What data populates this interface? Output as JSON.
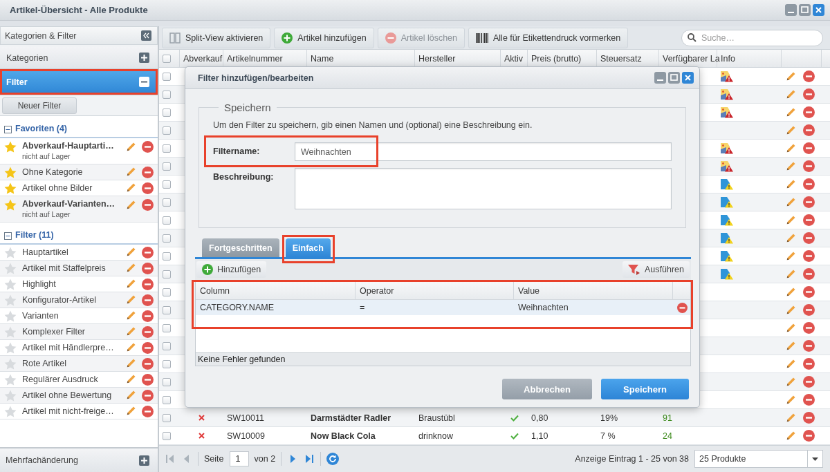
{
  "window": {
    "title": "Artikel-Übersicht - Alle Produkte"
  },
  "sidebar": {
    "title": "Kategorien & Filter",
    "sections": [
      {
        "label": "Kategorien",
        "expanded": false
      },
      {
        "label": "Filter",
        "expanded": true,
        "highlighted": true
      }
    ],
    "new_filter_button": "Neuer Filter",
    "groups": [
      {
        "label": "Favoriten (4)",
        "expanded": true,
        "items": [
          {
            "name": "Abverkauf-Hauptarti…",
            "note": "nicht auf Lager",
            "favorite": true
          },
          {
            "name": "Ohne Kategorie",
            "favorite": true
          },
          {
            "name": "Artikel ohne Bilder",
            "favorite": true
          },
          {
            "name": "Abverkauf-Varianten…",
            "note": "nicht auf Lager",
            "favorite": true
          }
        ]
      },
      {
        "label": "Filter (11)",
        "expanded": true,
        "items": [
          {
            "name": "Hauptartikel",
            "favorite": false
          },
          {
            "name": "Artikel mit Staffelpreis",
            "favorite": false
          },
          {
            "name": "Highlight",
            "favorite": false
          },
          {
            "name": "Konfigurator-Artikel",
            "favorite": false
          },
          {
            "name": "Varianten",
            "favorite": false
          },
          {
            "name": "Komplexer Filter",
            "favorite": false
          },
          {
            "name": "Artikel mit Händlerpre…",
            "favorite": false
          },
          {
            "name": "Rote Artikel",
            "favorite": false
          },
          {
            "name": "Regulärer Ausdruck",
            "favorite": false
          },
          {
            "name": "Artikel ohne Bewertung",
            "favorite": false
          },
          {
            "name": "Artikel mit nicht-freige…",
            "favorite": false
          }
        ]
      }
    ],
    "footer": "Mehrfachänderung"
  },
  "toolbar": {
    "buttons": [
      {
        "label": "Split-View aktivieren",
        "kind": "split",
        "disabled": false
      },
      {
        "label": "Artikel hinzufügen",
        "kind": "add",
        "disabled": false
      },
      {
        "label": "Artikel löschen",
        "kind": "delete",
        "disabled": true
      },
      {
        "label": "Alle für Etikettendruck vormerken",
        "kind": "barcode",
        "disabled": false
      }
    ],
    "search": {
      "placeholder": "Suche…"
    }
  },
  "grid": {
    "header_checked": false,
    "columns": [
      "Abverkauf",
      "Artikelnummer",
      "Name",
      "Hersteller",
      "Aktiv",
      "Preis (brutto)",
      "Steuersatz",
      "Verfügbarer La",
      "Info"
    ],
    "rows": [
      {
        "checked": false,
        "info": {
          "kind": "image-error"
        }
      },
      {
        "checked": false,
        "info": {
          "kind": "image-error"
        }
      },
      {
        "checked": false,
        "info": {
          "kind": "image-error"
        }
      },
      {
        "checked": false
      },
      {
        "checked": false,
        "info": {
          "kind": "image-error"
        }
      },
      {
        "checked": false,
        "info": {
          "kind": "image-error"
        }
      },
      {
        "checked": false,
        "info": {
          "kind": "text-warning"
        }
      },
      {
        "checked": false,
        "info": {
          "kind": "text-warning"
        }
      },
      {
        "checked": false,
        "info": {
          "kind": "text-warning"
        }
      },
      {
        "checked": false,
        "info": {
          "kind": "text-warning"
        }
      },
      {
        "checked": false,
        "info": {
          "kind": "text-warning"
        }
      },
      {
        "checked": false,
        "info": {
          "kind": "text-warning"
        }
      },
      {
        "checked": false
      },
      {
        "checked": false
      },
      {
        "checked": false
      },
      {
        "checked": false
      },
      {
        "checked": false
      },
      {
        "checked": false
      },
      {
        "checked": false
      },
      {
        "checked": false,
        "sale": false,
        "number": "SW10011",
        "name": "Darmstädter Radler",
        "maker": "Braustübl",
        "active": true,
        "price": "0,80",
        "tax": "19%",
        "stock": "91"
      },
      {
        "checked": false,
        "sale": false,
        "number": "SW10009",
        "name": "Now Black Cola",
        "maker": "drinknow",
        "active": true,
        "price": "1,10",
        "tax": "7 %",
        "stock": "24"
      }
    ]
  },
  "paging": {
    "nav": [
      {
        "kind": "first",
        "disabled": true
      },
      {
        "kind": "prev",
        "disabled": true
      },
      {
        "kind": "next",
        "disabled": false
      },
      {
        "kind": "last",
        "disabled": false
      }
    ],
    "page_label": "Seite",
    "page": "1",
    "of": "von 2",
    "summary": "Anzeige Eintrag 1 - 25 von 38",
    "page_size": "25 Produkte"
  },
  "dialog": {
    "title": "Filter hinzufügen/bearbeiten",
    "fieldset": "Speichern",
    "hint": "Um den Filter zu speichern, gib einen Namen und (optional) eine Beschreibung ein.",
    "fields": [
      {
        "label": "Filtername:",
        "kind": "text",
        "value": "Weihnachten",
        "highlighted": true
      },
      {
        "label": "Beschreibung:",
        "kind": "textarea"
      }
    ],
    "tabs": [
      {
        "label": "Fortgeschritten",
        "selected": false
      },
      {
        "label": "Einfach",
        "selected": true,
        "highlighted": true
      }
    ],
    "add_button": "Hinzufügen",
    "run_button": "Ausführen",
    "table": {
      "highlighted": true,
      "columns": [
        "Column",
        "Operator",
        "Value"
      ],
      "rows": [
        {
          "column": "CATEGORY.NAME",
          "operator": "=",
          "value": "Weihnachten"
        }
      ]
    },
    "status": "Keine Fehler gefunden",
    "buttons": [
      {
        "label": "Abbrechen",
        "kind": "secondary"
      },
      {
        "label": "Speichern",
        "kind": "primary"
      }
    ]
  }
}
